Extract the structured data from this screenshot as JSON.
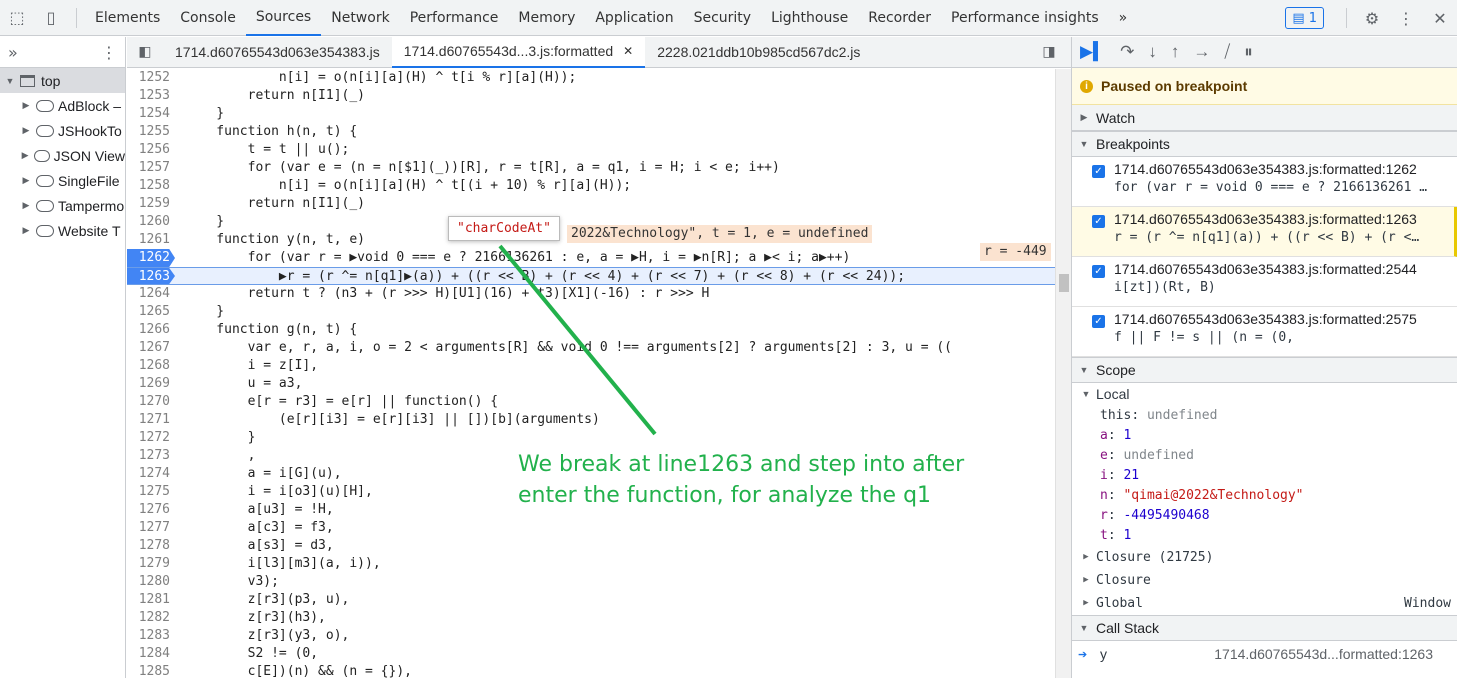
{
  "toolbar": {
    "tabs": [
      "Elements",
      "Console",
      "Sources",
      "Network",
      "Performance",
      "Memory",
      "Application",
      "Security",
      "Lighthouse",
      "Recorder",
      "Performance insights"
    ],
    "more_tabs_icon": "»",
    "issues_count": "1"
  },
  "navigator": {
    "items": [
      {
        "label": "top",
        "type": "frame"
      },
      {
        "label": "AdBlock –",
        "type": "cloud"
      },
      {
        "label": "JSHookTo",
        "type": "cloud"
      },
      {
        "label": "JSON View",
        "type": "cloud"
      },
      {
        "label": "SingleFile",
        "type": "cloud"
      },
      {
        "label": "Tampermo",
        "type": "cloud"
      },
      {
        "label": "Website T",
        "type": "cloud"
      }
    ]
  },
  "editor": {
    "tabs": [
      {
        "label": "1714.d60765543d063e354383.js",
        "active": false
      },
      {
        "label": "1714.d60765543d...3.js:formatted",
        "active": true
      },
      {
        "label": "2228.021ddb10b985cd567dc2.js",
        "active": false
      }
    ],
    "tooltip": "\"charCodeAt\"",
    "inline_values": {
      "l1261": "2022&Technology\", t = 1, e = undefined",
      "l1262": "r = -449"
    },
    "annotation": [
      "We break at line1263 and step into after",
      "enter the function, for analyze the q1"
    ],
    "lines": [
      {
        "n": "1252",
        "t": "            n[i] = o(n[i][a](H) ^ t[i % r][a](H));"
      },
      {
        "n": "1253",
        "t": "        return n[I1](_)"
      },
      {
        "n": "1254",
        "t": "    }"
      },
      {
        "n": "1255",
        "t": "    function h(n, t) {"
      },
      {
        "n": "1256",
        "t": "        t = t || u();"
      },
      {
        "n": "1257",
        "t": "        for (var e = (n = n[$1](_))[R], r = t[R], a = q1, i = H; i < e; i++)"
      },
      {
        "n": "1258",
        "t": "            n[i] = o(n[i][a](H) ^ t[(i + 10) % r][a](H));"
      },
      {
        "n": "1259",
        "t": "        return n[I1](_)"
      },
      {
        "n": "1260",
        "t": "    }"
      },
      {
        "n": "1261",
        "t": "    function y(n, t, e)"
      },
      {
        "n": "1262",
        "t": "        for (var r = ▶void 0 === e ? 2166136261 : e, a = ▶H, i = ▶n[R]; a ▶< i; a▶++)"
      },
      {
        "n": "1263",
        "t": "            ▶r = (r ^= n[q1]▶(a)) + ((r << B) + (r << 4) + (r << 7) + (r << 8) + (r << 24));"
      },
      {
        "n": "1264",
        "t": "        return t ? (n3 + (r >>> H)[U1](16) + t3)[X1](-16) : r >>> H"
      },
      {
        "n": "1265",
        "t": "    }"
      },
      {
        "n": "1266",
        "t": "    function g(n, t) {"
      },
      {
        "n": "1267",
        "t": "        var e, r, a, i, o = 2 < arguments[R] && void 0 !== arguments[2] ? arguments[2] : 3, u = (("
      },
      {
        "n": "1268",
        "t": "        i = z[I],"
      },
      {
        "n": "1269",
        "t": "        u = a3,"
      },
      {
        "n": "1270",
        "t": "        e[r = r3] = e[r] || function() {"
      },
      {
        "n": "1271",
        "t": "            (e[r][i3] = e[r][i3] || [])[b](arguments)"
      },
      {
        "n": "1272",
        "t": "        }"
      },
      {
        "n": "1273",
        "t": "        ,"
      },
      {
        "n": "1274",
        "t": "        a = i[G](u),"
      },
      {
        "n": "1275",
        "t": "        i = i[o3](u)[H],"
      },
      {
        "n": "1276",
        "t": "        a[u3] = !H,"
      },
      {
        "n": "1277",
        "t": "        a[c3] = f3,"
      },
      {
        "n": "1278",
        "t": "        a[s3] = d3,"
      },
      {
        "n": "1279",
        "t": "        i[l3][m3](a, i)),"
      },
      {
        "n": "1280",
        "t": "        v3);"
      },
      {
        "n": "1281",
        "t": "        z[r3](p3, u),"
      },
      {
        "n": "1282",
        "t": "        z[r3](h3),"
      },
      {
        "n": "1283",
        "t": "        z[r3](y3, o),"
      },
      {
        "n": "1284",
        "t": "        S2 != (0,"
      },
      {
        "n": "1285",
        "t": "        c[E])(n) && (n = {}),"
      }
    ]
  },
  "debugger": {
    "paused_label": "Paused on breakpoint",
    "panes": {
      "watch": "Watch",
      "breakpoints": "Breakpoints",
      "scope": "Scope",
      "call_stack": "Call Stack"
    },
    "breakpoints": [
      {
        "loc": "1714.d60765543d063e354383.js:formatted:1262",
        "snippet": "for (var r = void 0 === e ? 2166136261 …",
        "hit": false
      },
      {
        "loc": "1714.d60765543d063e354383.js:formatted:1263",
        "snippet": "r = (r ^= n[q1](a)) + ((r << B) + (r <…",
        "hit": true
      },
      {
        "loc": "1714.d60765543d063e354383.js:formatted:2544",
        "snippet": "i[zt])(Rt, B)",
        "hit": false
      },
      {
        "loc": "1714.d60765543d063e354383.js:formatted:2575",
        "snippet": "f || F != s || (n = (0,",
        "hit": false
      }
    ],
    "scope": {
      "local_label": "Local",
      "vars": [
        {
          "k": "this",
          "v": "undefined",
          "kind": "undef",
          "plain": true
        },
        {
          "k": "a",
          "v": "1",
          "kind": "num"
        },
        {
          "k": "e",
          "v": "undefined",
          "kind": "undef"
        },
        {
          "k": "i",
          "v": "21",
          "kind": "num"
        },
        {
          "k": "n",
          "v": "\"qimai@2022&Technology\"",
          "kind": "str"
        },
        {
          "k": "r",
          "v": "-4495490468",
          "kind": "num"
        },
        {
          "k": "t",
          "v": "1",
          "kind": "num"
        }
      ],
      "closure1": "Closure (21725)",
      "closure2": "Closure",
      "global": "Global",
      "global_value": "Window"
    },
    "call_stack": [
      {
        "fn": "y",
        "loc": "1714.d60765543d...formatted:1263"
      }
    ]
  },
  "colors": {
    "accent": "#1a73e8",
    "annotation": "#22b14c",
    "breakpoint": "#4285f4"
  }
}
